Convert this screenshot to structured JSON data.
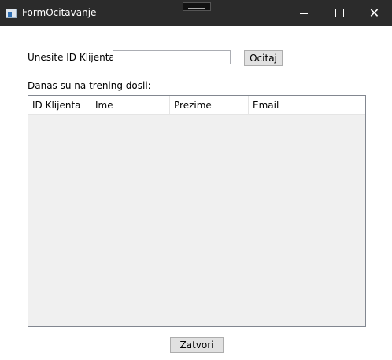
{
  "window": {
    "title": "FormOcitavanje",
    "minimize_icon": "minimize-icon",
    "maximize_icon": "maximize-icon",
    "close_icon": "close-icon",
    "close_glyph": "✕"
  },
  "form": {
    "client_id_label": "Unesite ID Klijenta:",
    "client_id_value": "",
    "read_button": "Ocitaj",
    "list_label": "Danas su na trening dosli:",
    "grid": {
      "columns": [
        "ID Klijenta",
        "Ime",
        "Prezime",
        "Email"
      ],
      "rows": []
    },
    "close_button": "Zatvori"
  }
}
